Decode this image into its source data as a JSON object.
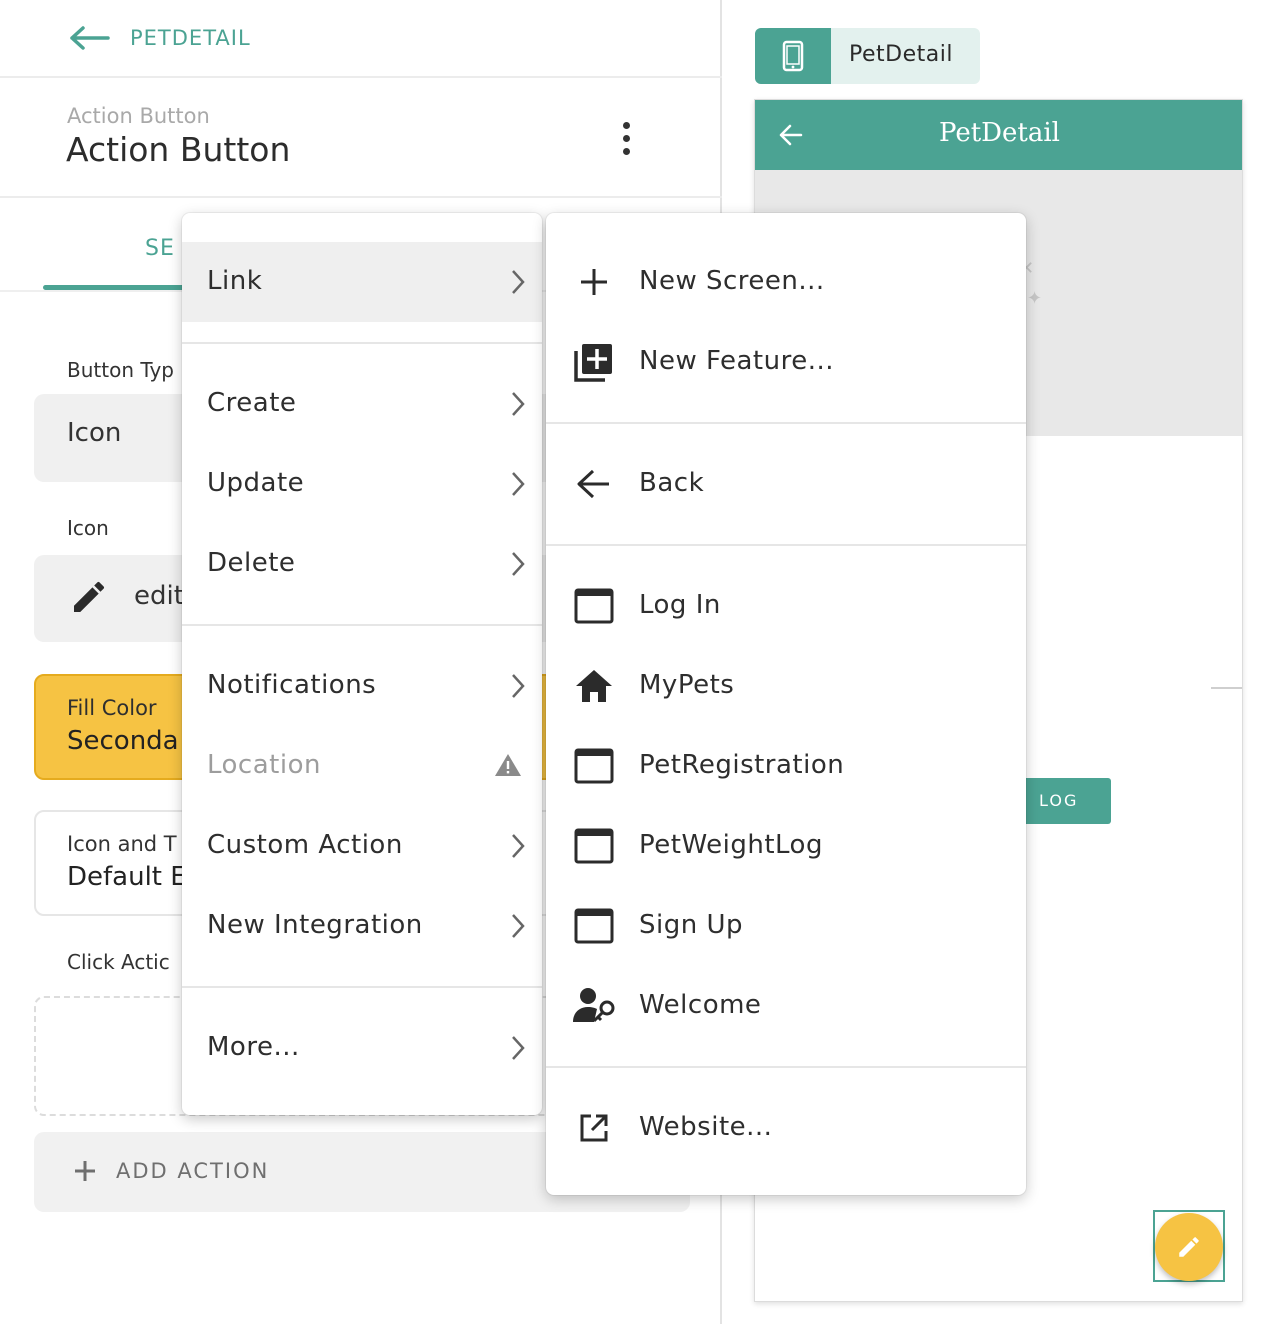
{
  "header": {
    "back_label": "PETDETAIL"
  },
  "component": {
    "subtitle": "Action Button",
    "title": "Action Button"
  },
  "tabs": {
    "settings_partial": "SE"
  },
  "fields": {
    "button_type_label": "Button Typ",
    "button_type_value": "Icon",
    "icon_label": "Icon",
    "icon_value": "edit",
    "fill_color_label": "Fill Color",
    "fill_color_value": "Seconda",
    "icon_text_label": "Icon and T",
    "icon_text_value": "Default E",
    "click_actions_label": "Click Actic",
    "add_action_label": "ADD ACTION"
  },
  "preview": {
    "screen_chip_label": "PetDetail",
    "app_title": "PetDetail",
    "log_button_label": "LOG"
  },
  "action_menu": {
    "items": [
      {
        "label": "Link"
      },
      {
        "label": "Create"
      },
      {
        "label": "Update"
      },
      {
        "label": "Delete"
      },
      {
        "label": "Notifications"
      },
      {
        "label": "Location"
      },
      {
        "label": "Custom Action"
      },
      {
        "label": "New Integration"
      },
      {
        "label": "More..."
      }
    ]
  },
  "link_menu": {
    "items": [
      {
        "label": "New Screen...",
        "icon": "plus-icon"
      },
      {
        "label": "New Feature...",
        "icon": "library-add-icon"
      },
      {
        "label": "Back",
        "icon": "arrow-left-icon"
      },
      {
        "label": "Log In",
        "icon": "screen-icon"
      },
      {
        "label": "MyPets",
        "icon": "home-icon"
      },
      {
        "label": "PetRegistration",
        "icon": "screen-icon"
      },
      {
        "label": "PetWeightLog",
        "icon": "screen-icon"
      },
      {
        "label": "Sign Up",
        "icon": "screen-icon"
      },
      {
        "label": "Welcome",
        "icon": "user-key-icon"
      },
      {
        "label": "Website...",
        "icon": "external-link-icon"
      }
    ]
  },
  "colors": {
    "accent": "#4ba393",
    "secondary": "#f6c343"
  }
}
